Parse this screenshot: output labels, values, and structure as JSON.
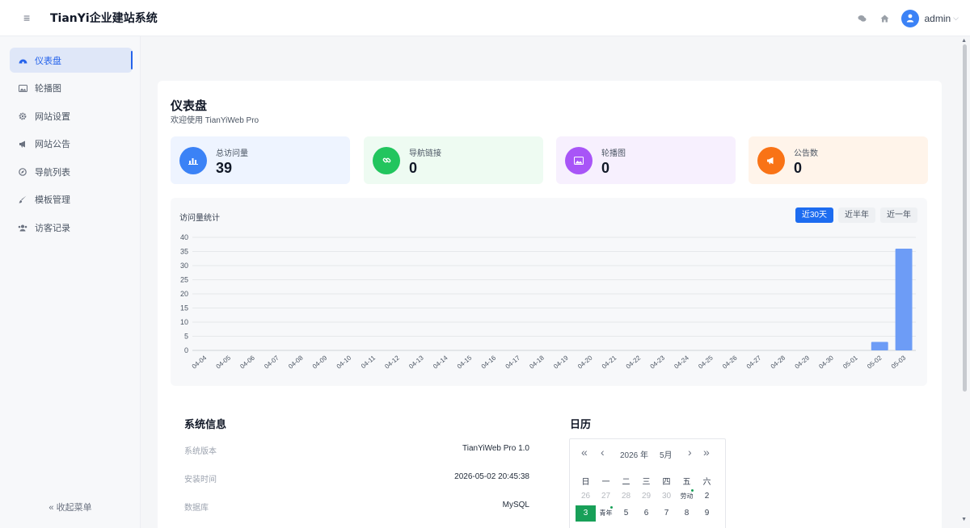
{
  "header": {
    "menu_icon": "hamburger-icon",
    "title": "TianYi企业建站系统",
    "user": "admin",
    "icons": [
      "chat-icon",
      "home-icon",
      "user-avatar-icon",
      "chevron-down-icon"
    ]
  },
  "sidebar": {
    "items": [
      {
        "label": "仪表盘",
        "icon": "dashboard-icon",
        "active": true
      },
      {
        "label": "轮播图",
        "icon": "image-icon"
      },
      {
        "label": "网站设置",
        "icon": "gear-icon"
      },
      {
        "label": "网站公告",
        "icon": "megaphone-icon"
      },
      {
        "label": "导航列表",
        "icon": "compass-icon"
      },
      {
        "label": "模板管理",
        "icon": "brush-icon"
      },
      {
        "label": "访客记录",
        "icon": "users-icon"
      }
    ],
    "collapse_label": "« 收起菜单"
  },
  "page": {
    "title": "仪表盘",
    "subtitle": "欢迎使用 TianYiWeb Pro"
  },
  "stats": [
    {
      "label": "总访问量",
      "value": "39",
      "icon": "bar-chart-icon",
      "color": "#3b82f6",
      "bg": "#eef4ff"
    },
    {
      "label": "导航链接",
      "value": "0",
      "icon": "link-icon",
      "color": "#22c55e",
      "bg": "#eefbf2"
    },
    {
      "label": "轮播图",
      "value": "0",
      "icon": "image-icon",
      "color": "#a855f7",
      "bg": "#f7f0fe"
    },
    {
      "label": "公告数",
      "value": "0",
      "icon": "megaphone-icon",
      "color": "#f97316",
      "bg": "#fff4ea"
    }
  ],
  "chart": {
    "title": "访问量统计",
    "ranges": [
      "近30天",
      "近半年",
      "近一年"
    ],
    "active_range": "近30天"
  },
  "chart_data": {
    "type": "bar",
    "categories": [
      "04-04",
      "04-05",
      "04-06",
      "04-07",
      "04-08",
      "04-09",
      "04-10",
      "04-11",
      "04-12",
      "04-13",
      "04-14",
      "04-15",
      "04-16",
      "04-17",
      "04-18",
      "04-19",
      "04-20",
      "04-21",
      "04-22",
      "04-23",
      "04-24",
      "04-25",
      "04-26",
      "04-27",
      "04-28",
      "04-29",
      "04-30",
      "05-01",
      "05-02",
      "05-03"
    ],
    "values": [
      0,
      0,
      0,
      0,
      0,
      0,
      0,
      0,
      0,
      0,
      0,
      0,
      0,
      0,
      0,
      0,
      0,
      0,
      0,
      0,
      0,
      0,
      0,
      0,
      0,
      0,
      0,
      0,
      3,
      36
    ],
    "ylim": [
      0,
      40
    ],
    "yticks": [
      0,
      5,
      10,
      15,
      20,
      25,
      30,
      35,
      40
    ],
    "bar_color": "#6d9cf6",
    "grid": true
  },
  "system": {
    "title": "系统信息",
    "rows": [
      {
        "key": "系统版本",
        "value": "TianYiWeb Pro 1.0"
      },
      {
        "key": "安装时间",
        "value": "2026-05-02 20:45:38"
      },
      {
        "key": "数据库",
        "value": "MySQL"
      }
    ]
  },
  "calendar": {
    "title": "日历",
    "year": "2026 年",
    "month": "5月",
    "weekdays": [
      "日",
      "一",
      "二",
      "三",
      "四",
      "五",
      "六"
    ],
    "rows": [
      [
        {
          "d": "26",
          "muted": true
        },
        {
          "d": "27",
          "muted": true
        },
        {
          "d": "28",
          "muted": true
        },
        {
          "d": "29",
          "muted": true
        },
        {
          "d": "30",
          "muted": true
        },
        {
          "d": "劳动",
          "small": true,
          "dot": true
        },
        {
          "d": "2"
        }
      ],
      [
        {
          "d": "3",
          "today": true
        },
        {
          "d": "青年",
          "small": true,
          "dot": true
        },
        {
          "d": "5"
        },
        {
          "d": "6"
        },
        {
          "d": "7"
        },
        {
          "d": "8"
        },
        {
          "d": "9"
        }
      ]
    ],
    "nav": [
      "double-left-icon",
      "left-icon",
      "right-icon",
      "double-right-icon"
    ]
  }
}
